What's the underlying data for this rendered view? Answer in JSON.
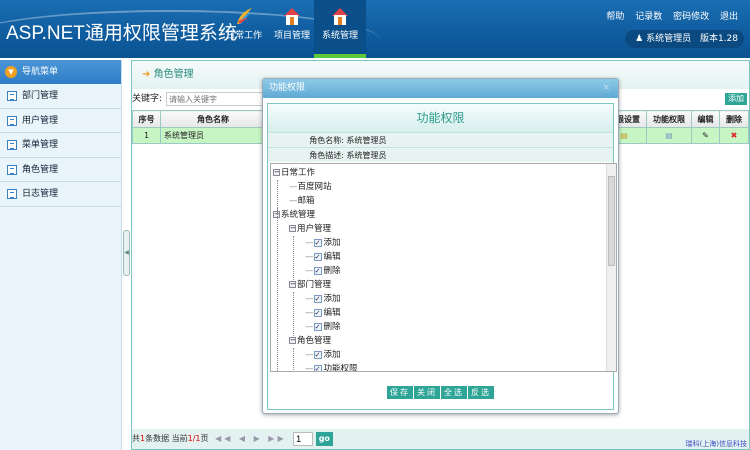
{
  "header": {
    "title": "ASP.NET通用权限管理系统",
    "nav": [
      {
        "label": "日常工作",
        "icon": "feather-icon"
      },
      {
        "label": "项目管理",
        "icon": "house-icon"
      },
      {
        "label": "系统管理",
        "icon": "house-icon",
        "active": true
      }
    ],
    "links": [
      "帮助",
      "记录数",
      "密码修改",
      "退出"
    ],
    "user": "系统管理员",
    "version": "版本1.28"
  },
  "sidebar": {
    "title": "导航菜单",
    "items": [
      "部门管理",
      "用户管理",
      "菜单管理",
      "角色管理",
      "日志管理"
    ]
  },
  "main": {
    "title": "角色管理",
    "keyword_label": "关键字:",
    "keyword_placeholder": "请输入关键字",
    "add": "添加",
    "columns": [
      "序号",
      "角色名称",
      "权限设置",
      "功能权限",
      "编辑",
      "删除"
    ],
    "rows": [
      {
        "no": "1",
        "name": "系统管理员"
      }
    ],
    "footer": {
      "p1": "共",
      "total": "1",
      "p2": "条数据 当前",
      "page": "1/1",
      "p3": "页",
      "page_input": "1",
      "go": "go",
      "copyright": "瑞科(上海)信息科技"
    }
  },
  "dialog": {
    "title": "功能权限",
    "close": "×",
    "heading": "功能权限",
    "role_name_label": "角色名称:",
    "role_name": "系统管理员",
    "role_desc_label": "角色描述:",
    "role_desc": "系统管理员",
    "tree": [
      {
        "t": "日常工作",
        "lv": 0,
        "n": 1
      },
      {
        "t": "百度网站",
        "lv": 1
      },
      {
        "t": "邮箱",
        "lv": 1
      },
      {
        "t": "系统管理",
        "lv": 0,
        "n": 1
      },
      {
        "t": "用户管理",
        "lv": 1,
        "n": 1
      },
      {
        "t": "添加",
        "lv": 2,
        "c": 1
      },
      {
        "t": "编辑",
        "lv": 2,
        "c": 1
      },
      {
        "t": "删除",
        "lv": 2,
        "c": 1
      },
      {
        "t": "部门管理",
        "lv": 1,
        "n": 1
      },
      {
        "t": "添加",
        "lv": 2,
        "c": 1
      },
      {
        "t": "编辑",
        "lv": 2,
        "c": 1
      },
      {
        "t": "删除",
        "lv": 2,
        "c": 1
      },
      {
        "t": "角色管理",
        "lv": 1,
        "n": 1
      },
      {
        "t": "添加",
        "lv": 2,
        "c": 1
      },
      {
        "t": "功能权限",
        "lv": 2,
        "c": 1
      }
    ],
    "buttons": [
      "保存",
      "关闭",
      "全选",
      "反选"
    ]
  }
}
